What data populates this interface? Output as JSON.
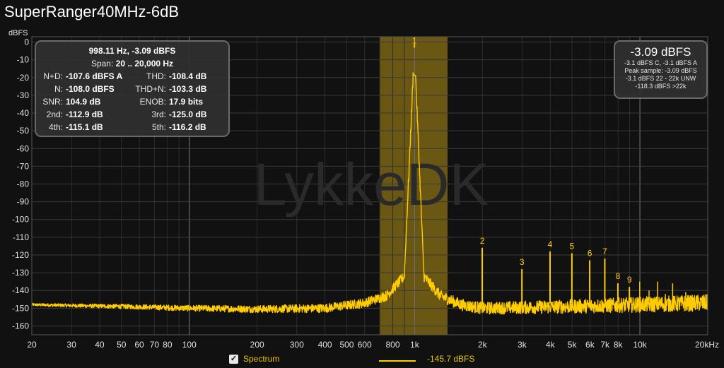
{
  "title": "SuperRanger40MHz-6dB",
  "watermark": "LykkeDK",
  "colors": {
    "trace": "#ffcc00",
    "band": "#7a6414",
    "background": "#111111",
    "grid": "#3a3a3a"
  },
  "measurements": {
    "header": "998.11 Hz, -3.09 dBFS",
    "span_label": "Span:",
    "span_value": "20 .. 20,000 Hz",
    "rows": [
      {
        "l_label": "N+D:",
        "l_value": "-107.6 dBFS A",
        "r_label": "THD:",
        "r_value": "-108.4 dB"
      },
      {
        "l_label": "N:",
        "l_value": "-108.0 dBFS",
        "r_label": "THD+N:",
        "r_value": "-103.3 dB"
      },
      {
        "l_label": "SNR:",
        "l_value": "104.9 dB",
        "r_label": "ENOB:",
        "r_value": "17.9 bits"
      },
      {
        "l_label": "2nd:",
        "l_value": "-112.9 dB",
        "r_label": "3rd:",
        "r_value": "-125.0 dB"
      },
      {
        "l_label": "4th:",
        "l_value": "-115.1 dB",
        "r_label": "5th:",
        "r_value": "-116.2 dB"
      }
    ]
  },
  "level_panel": {
    "big": "-3.09 dBFS",
    "lines": [
      "-3.1 dBFS C, -3.1 dBFS A",
      "Peak sample: -3.09 dBFS",
      "-3.1 dBFS 22 - 22k UNW",
      "-118.3 dBFS >22k"
    ]
  },
  "legend": {
    "checkbox_label": "Spectrum",
    "checked": true,
    "line_value": "-145.7 dBFS"
  },
  "chart_data": {
    "type": "line",
    "title": "SuperRanger40MHz-6dB",
    "ylabel": "dBFS",
    "xlabel": "",
    "x_scale": "log",
    "xlim": [
      20,
      20000
    ],
    "ylim": [
      -165,
      3
    ],
    "grid": true,
    "y_ticks": [
      0,
      -10,
      -20,
      -30,
      -40,
      -50,
      -60,
      -70,
      -80,
      -90,
      -100,
      -110,
      -120,
      -130,
      -140,
      -150,
      -160
    ],
    "x_ticks": [
      {
        "v": 20,
        "label": "20"
      },
      {
        "v": 30,
        "label": "30"
      },
      {
        "v": 40,
        "label": "40"
      },
      {
        "v": 50,
        "label": "50"
      },
      {
        "v": 60,
        "label": "60"
      },
      {
        "v": 70,
        "label": "70"
      },
      {
        "v": 80,
        "label": "80"
      },
      {
        "v": 100,
        "label": "100"
      },
      {
        "v": 200,
        "label": "200"
      },
      {
        "v": 300,
        "label": "300"
      },
      {
        "v": 400,
        "label": "400"
      },
      {
        "v": 500,
        "label": "500"
      },
      {
        "v": 600,
        "label": "600"
      },
      {
        "v": 800,
        "label": "800"
      },
      {
        "v": 1000,
        "label": "1k"
      },
      {
        "v": 2000,
        "label": "2k"
      },
      {
        "v": 3000,
        "label": "3k"
      },
      {
        "v": 4000,
        "label": "4k"
      },
      {
        "v": 5000,
        "label": "5k"
      },
      {
        "v": 6000,
        "label": "6k"
      },
      {
        "v": 7000,
        "label": "7k"
      },
      {
        "v": 8000,
        "label": "8k"
      },
      {
        "v": 10000,
        "label": "10k"
      },
      {
        "v": 20000,
        "label": "20kHz"
      }
    ],
    "highlight_band": [
      700,
      1400
    ],
    "harmonics": [
      {
        "n": "1",
        "f": 998,
        "db": -3.1
      },
      {
        "n": "2",
        "f": 1996,
        "db": -116
      },
      {
        "n": "3",
        "f": 2994,
        "db": -128
      },
      {
        "n": "4",
        "f": 3992,
        "db": -118
      },
      {
        "n": "5",
        "f": 4990,
        "db": -119
      },
      {
        "n": "6",
        "f": 5988,
        "db": -123
      },
      {
        "n": "7",
        "f": 6986,
        "db": -122
      },
      {
        "n": "8",
        "f": 7984,
        "db": -136
      },
      {
        "n": "9",
        "f": 8982,
        "db": -138
      }
    ],
    "spur_peaks": [
      {
        "f": 9980,
        "db": -135
      },
      {
        "f": 10978,
        "db": -140
      },
      {
        "f": 11976,
        "db": -135
      },
      {
        "f": 12974,
        "db": -142
      },
      {
        "f": 13972,
        "db": -136
      },
      {
        "f": 15968,
        "db": -141
      },
      {
        "f": 17964,
        "db": -143
      },
      {
        "f": 19960,
        "db": -145
      }
    ],
    "noise_floor": [
      {
        "f": 20,
        "db": -148
      },
      {
        "f": 30,
        "db": -148.5
      },
      {
        "f": 50,
        "db": -149
      },
      {
        "f": 100,
        "db": -150
      },
      {
        "f": 200,
        "db": -150.5
      },
      {
        "f": 400,
        "db": -150
      },
      {
        "f": 600,
        "db": -147
      },
      {
        "f": 750,
        "db": -143
      },
      {
        "f": 900,
        "db": -132
      },
      {
        "f": 998,
        "db": -3.1
      },
      {
        "f": 1100,
        "db": -132
      },
      {
        "f": 1300,
        "db": -143
      },
      {
        "f": 1600,
        "db": -148
      },
      {
        "f": 2000,
        "db": -150
      },
      {
        "f": 5000,
        "db": -149
      },
      {
        "f": 10000,
        "db": -148
      },
      {
        "f": 20000,
        "db": -147
      }
    ]
  }
}
